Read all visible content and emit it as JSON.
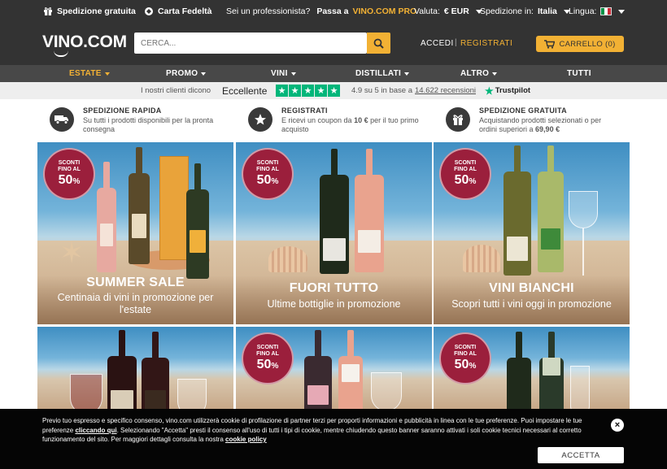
{
  "topbar": {
    "free_shipping": "Spedizione gratuita",
    "loyalty": "Carta Fedeltà",
    "pro_question": "Sei un professionista?",
    "pro_link_prefix": "Passa a",
    "pro_link_brand": "VINO.COM PRO",
    "currency_label": "Valuta:",
    "currency_value": "€ EUR",
    "ship_label": "Spedizione in:",
    "ship_value": "Italia",
    "language_label": "Lingua:"
  },
  "header": {
    "logo": "VINO.COM",
    "search_placeholder": "CERCA...",
    "login": "ACCEDI",
    "separator": "|",
    "register": "REGISTRATI",
    "cart": "CARRELLO (0)"
  },
  "nav": {
    "items": [
      {
        "label": "ESTATE",
        "active": true
      },
      {
        "label": "PROMO"
      },
      {
        "label": "VINI"
      },
      {
        "label": "DISTILLATI"
      },
      {
        "label": "ALTRO"
      },
      {
        "label": "TUTTI"
      }
    ]
  },
  "trustpilot": {
    "intro": "I nostri clienti dicono",
    "rating_word": "Eccellente",
    "score_text": "4.9 su 5 in base a",
    "reviews": "14.622 recensioni",
    "brand": "Trustpilot",
    "star_color": "#00b67a"
  },
  "benefits": [
    {
      "icon": "truck-icon",
      "title": "SPEDIZIONE RAPIDA",
      "desc": "Su tutti i prodotti disponibili per la pronta consegna"
    },
    {
      "icon": "star-icon",
      "title": "REGISTRATI",
      "desc_pre": "E ricevi un coupon da ",
      "desc_bold": "10 €",
      "desc_post": " per il tuo primo acquisto"
    },
    {
      "icon": "gift-icon",
      "title": "SPEDIZIONE GRATUITA",
      "desc_pre": "Acquistando prodotti selezionati o per ordini superiori a ",
      "desc_bold": "69,90 €",
      "desc_post": ""
    }
  ],
  "badge": {
    "line1": "SCONTI",
    "line2": "FINO AL",
    "value": "50",
    "unit": "%"
  },
  "tiles": [
    {
      "title": "SUMMER SALE",
      "subtitle": "Centinaia di vini in promozione per l'estate"
    },
    {
      "title": "FUORI TUTTO",
      "subtitle": "Ultime bottiglie in promozione"
    },
    {
      "title": "VINI BIANCHI",
      "subtitle": "Scopri tutti i vini oggi in promozione"
    }
  ],
  "cookie": {
    "text1": "Previo tuo espresso e specifico consenso, vino.com utilizzerà cookie di profilazione di partner terzi per proporti informazioni e pubblicità in linea con le tue preferenze. Puoi impostare le tue preferenze ",
    "link1": "cliccando qui",
    "text2": ". Selezionando \"Accetta\" presti il consenso all'uso di tutti i tipi di cookie, mentre chiudendo questo banner saranno attivati i soli cookie tecnici necessari al corretto funzionamento del sito. Per maggiori dettagli consulta la nostra ",
    "link2": "cookie policy",
    "accept": "ACCETTA",
    "close": "×"
  },
  "colors": {
    "accent": "#f2b134",
    "dark": "#333333",
    "badge": "#9b1f3c"
  }
}
